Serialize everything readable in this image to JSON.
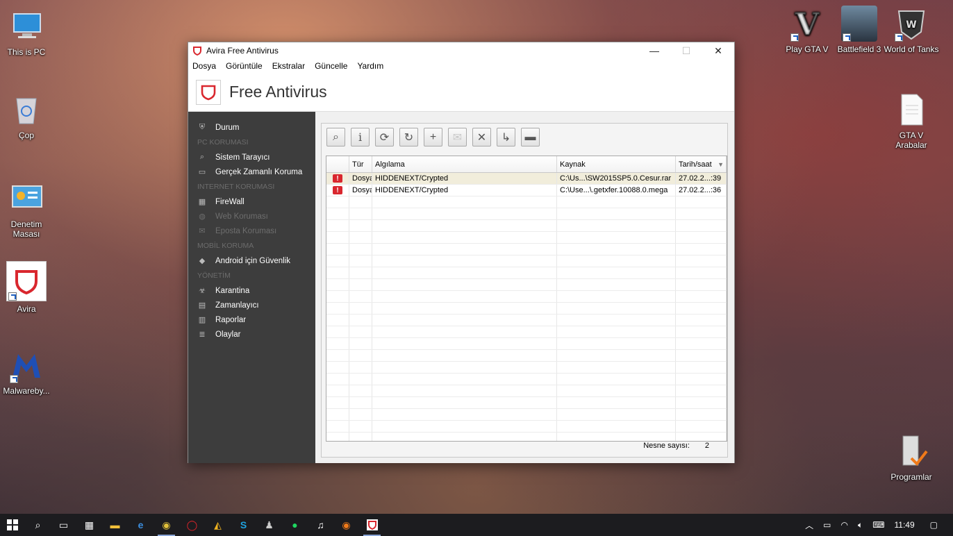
{
  "desktop": {
    "left_icons": [
      {
        "label": "This is PC",
        "icon": "computer-icon"
      },
      {
        "label": "Çop",
        "icon": "recycle-bin-icon"
      },
      {
        "label": "Denetim Masası",
        "icon": "control-panel-icon"
      },
      {
        "label": "Avira",
        "icon": "avira-icon"
      },
      {
        "label": "Malwareby...",
        "icon": "malwarebytes-icon"
      }
    ],
    "right_icons": [
      {
        "label": "Play GTA V",
        "icon": "gta-v-icon"
      },
      {
        "label": "Battlefield 3",
        "icon": "battlefield-icon"
      },
      {
        "label": "World of Tanks",
        "icon": "world-of-tanks-icon"
      },
      {
        "label": "GTA V Arabalar",
        "icon": "document-icon"
      },
      {
        "label": "Programlar",
        "icon": "programs-icon"
      }
    ]
  },
  "window": {
    "title": "Avira Free Antivirus",
    "minimize": "—",
    "maximize": "☐",
    "close": "✕",
    "menu": [
      "Dosya",
      "Görüntüle",
      "Ekstralar",
      "Güncelle",
      "Yardım"
    ],
    "brand": "Free Antivirus",
    "accent": "#d9272e"
  },
  "sidebar": {
    "status": "Durum",
    "pc_header": "PC KORUMASI",
    "system_scanner": "Sistem Tarayıcı",
    "realtime": "Gerçek Zamanlı Koruma",
    "internet_header": "INTERNET KORUMASI",
    "firewall": "FireWall",
    "web": "Web Koruması",
    "email": "Eposta Koruması",
    "mobile_header": "MOBİL KORUMA",
    "android": "Android için Güvenlik",
    "admin_header": "YÖNETİM",
    "quarantine": "Karantina",
    "scheduler": "Zamanlayıcı",
    "reports": "Raporlar",
    "events": "Olaylar"
  },
  "quarantine": {
    "columns": [
      "",
      "Tür",
      "Algılama",
      "Kaynak",
      "Tarih/saat"
    ],
    "rows": [
      {
        "type": "Dosya",
        "detection": "HIDDENEXT/Crypted",
        "source": "C:\\Us...\\SW2015SP5.0.Cesur.rar",
        "date": "27.02.2...:39"
      },
      {
        "type": "Dosya",
        "detection": "HIDDENEXT/Crypted",
        "source": "C:\\Use...\\.getxfer.10088.0.mega",
        "date": "27.02.2...:36"
      }
    ],
    "count_label": "Nesne sayısı:",
    "count": "2"
  },
  "taskbar": {
    "time": "11:49"
  }
}
